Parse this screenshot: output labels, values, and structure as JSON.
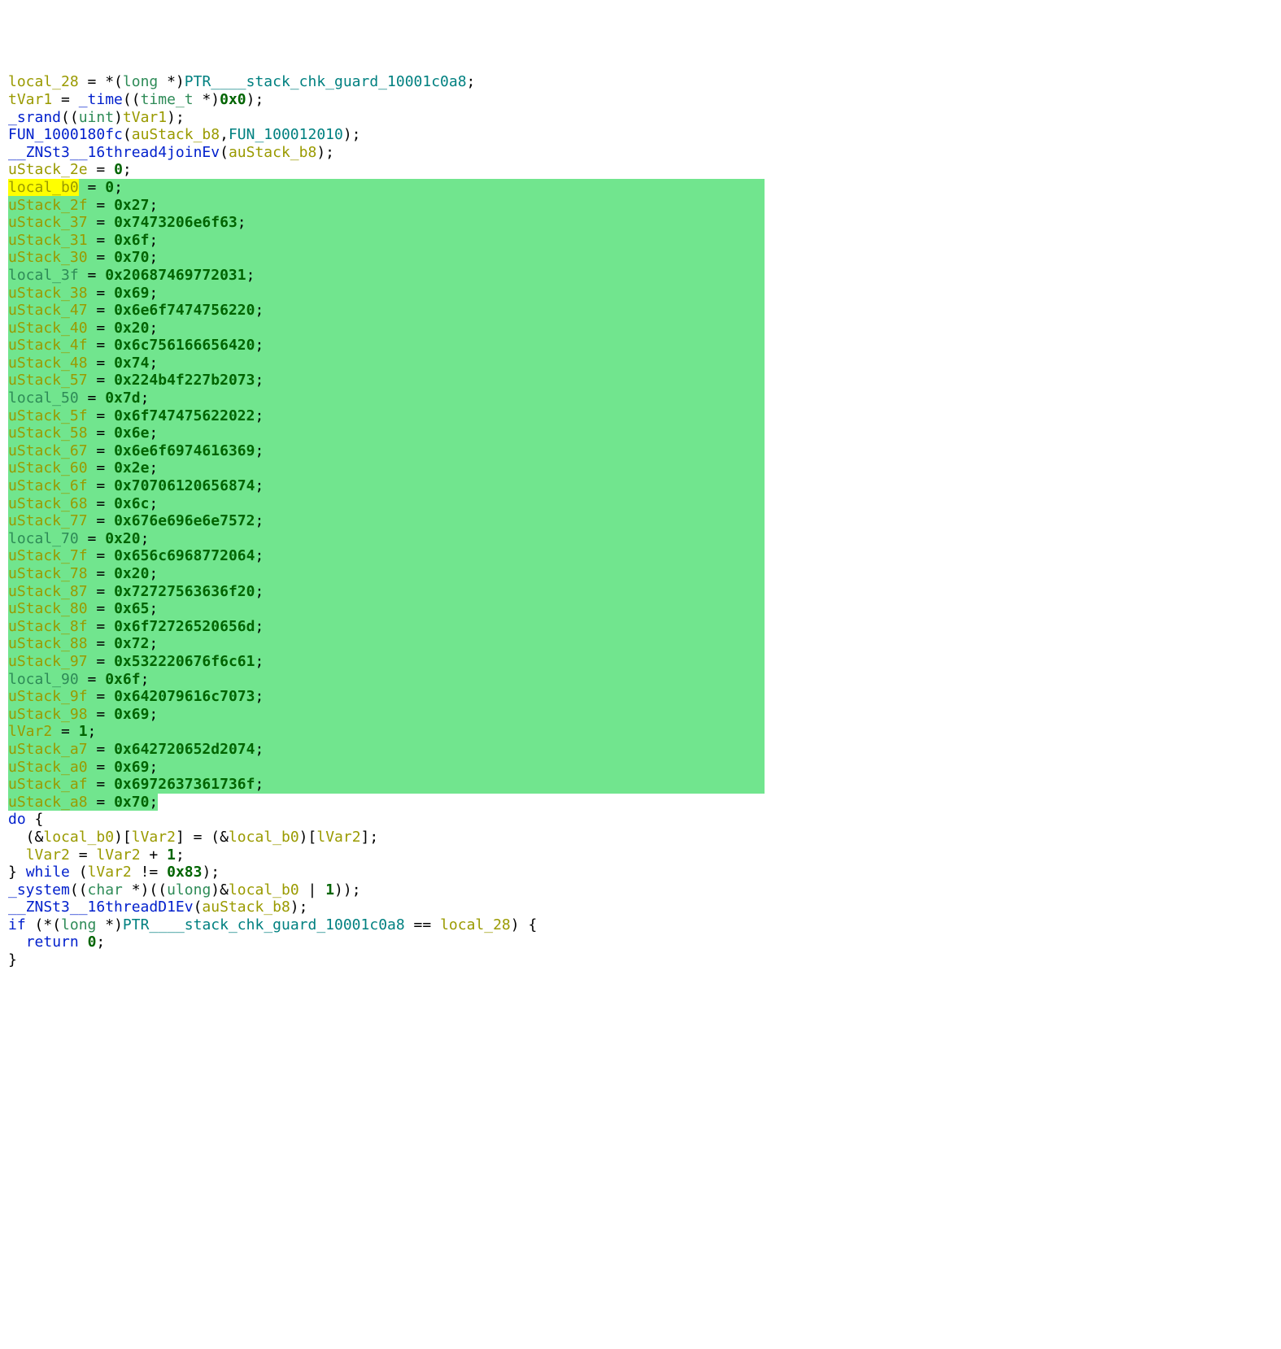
{
  "tokens": {
    "local_28": "local_28",
    "star_long": "*(",
    "long": "long",
    "star_close": " *)",
    "ptr_guard": "PTR____stack_chk_guard_10001c0a8",
    "semi": ";",
    "tVar1": "tVar1",
    "eq": " = ",
    "t_time": "_time",
    "lp": "((",
    "time_t": "time_t",
    "time_arg": " *)",
    "zero_x0": "0x0",
    "cp2": ");",
    "srand": "_srand",
    "uint_open": "((",
    "uint": "uint",
    "uint_close": ")",
    "tVar1b": "tVar1",
    "close_paren_semi": ");",
    "fun80": "FUN_1000180fc",
    "ap": "(",
    "auStack_b8": "auStack_b8",
    "comma": ",",
    "fun20": "FUN_100012010",
    "cp": ");",
    "threadjoin": "__ZNSt3__16thread4joinEv",
    "auStack_b8b": "auStack_b8",
    "uStack_2e": "uStack_2e",
    "zero": "0",
    "local_b0": "local_b0",
    "uStack_2f": "uStack_2f",
    "v2f": "0x27",
    "uStack_37": "uStack_37",
    "v37": "0x7473206e6f63",
    "uStack_31": "uStack_31",
    "v31": "0x6f",
    "uStack_30": "uStack_30",
    "v30": "0x70",
    "local_3f": "local_3f",
    "v3f": "0x20687469772031",
    "uStack_38": "uStack_38",
    "v38": "0x69",
    "uStack_47": "uStack_47",
    "v47": "0x6e6f7474756220",
    "uStack_40": "uStack_40",
    "v40": "0x20",
    "uStack_4f": "uStack_4f",
    "v4f": "0x6c756166656420",
    "uStack_48": "uStack_48",
    "v48": "0x74",
    "uStack_57": "uStack_57",
    "v57": "0x224b4f227b2073",
    "local_50": "local_50",
    "v50": "0x7d",
    "uStack_5f": "uStack_5f",
    "v5f": "0x6f747475622022",
    "uStack_58": "uStack_58",
    "v58": "0x6e",
    "uStack_67": "uStack_67",
    "v67": "0x6e6f6974616369",
    "uStack_60": "uStack_60",
    "v60": "0x2e",
    "uStack_6f": "uStack_6f",
    "v6f": "0x70706120656874",
    "uStack_68": "uStack_68",
    "v68": "0x6c",
    "uStack_77": "uStack_77",
    "v77": "0x676e696e6e7572",
    "local_70": "local_70",
    "v70": "0x20",
    "uStack_7f": "uStack_7f",
    "v7f": "0x656c6968772064",
    "uStack_78": "uStack_78",
    "v78": "0x20",
    "uStack_87": "uStack_87",
    "v87": "0x72727563636f20",
    "uStack_80": "uStack_80",
    "v80": "0x65",
    "uStack_8f": "uStack_8f",
    "v8f": "0x6f72726520656d",
    "uStack_88": "uStack_88",
    "v88": "0x72",
    "uStack_97": "uStack_97",
    "v97": "0x532220676f6c61",
    "local_90": "local_90",
    "v90": "0x6f",
    "uStack_9f": "uStack_9f",
    "v9f": "0x642079616c7073",
    "uStack_98": "uStack_98",
    "v98": "0x69",
    "lVar2": "lVar2",
    "one": "1",
    "uStack_a7": "uStack_a7",
    "va7": "0x642720652d2074",
    "uStack_a0": "uStack_a0",
    "va0": "0x69",
    "uStack_af": "uStack_af",
    "vaf": "0x6972637361736f",
    "uStack_a8": "uStack_a8",
    "va8": "0x70",
    "do": "do",
    "obrace": " {",
    "indent": "  ",
    "amp": "(&",
    "local_b0b": "local_b0",
    "idx_close": ")[",
    "lVar2b": "lVar2",
    "idx_close2": "]",
    "eq2": " = ",
    "amp2": "(&",
    "local_b0c": "local_b0",
    "idx_close3": ")[",
    "lVar2c": "lVar2",
    "idx_close4": "];",
    "lVar2d": "lVar2",
    "plus": " + ",
    "one2": "1",
    "cbrace": "} ",
    "while": "while",
    "wp": " (",
    "lVar2e": "lVar2",
    "neq": " != ",
    "lim": "0x83",
    "wc": ");",
    "system": "_system",
    "char_open": "((",
    "char": "char",
    "char_close": " *)((",
    "ulong": "ulong",
    "ul_close": ")&",
    "local_b0d": "local_b0",
    "or": " | ",
    "one3": "1",
    "sys_close": "));",
    "threadD1": "__ZNSt3__16threadD1Ev",
    "if": "if",
    "if_open": " (*(",
    "long2": "long",
    "long_close": " *)",
    "ptr_guard2": "PTR____stack_chk_guard_10001c0a8",
    "eqeq": " == ",
    "local_28b": "local_28",
    "if_close": ") {",
    "return": "return",
    "ret_sp": " ",
    "zero2": "0",
    "rbrace": "}"
  }
}
